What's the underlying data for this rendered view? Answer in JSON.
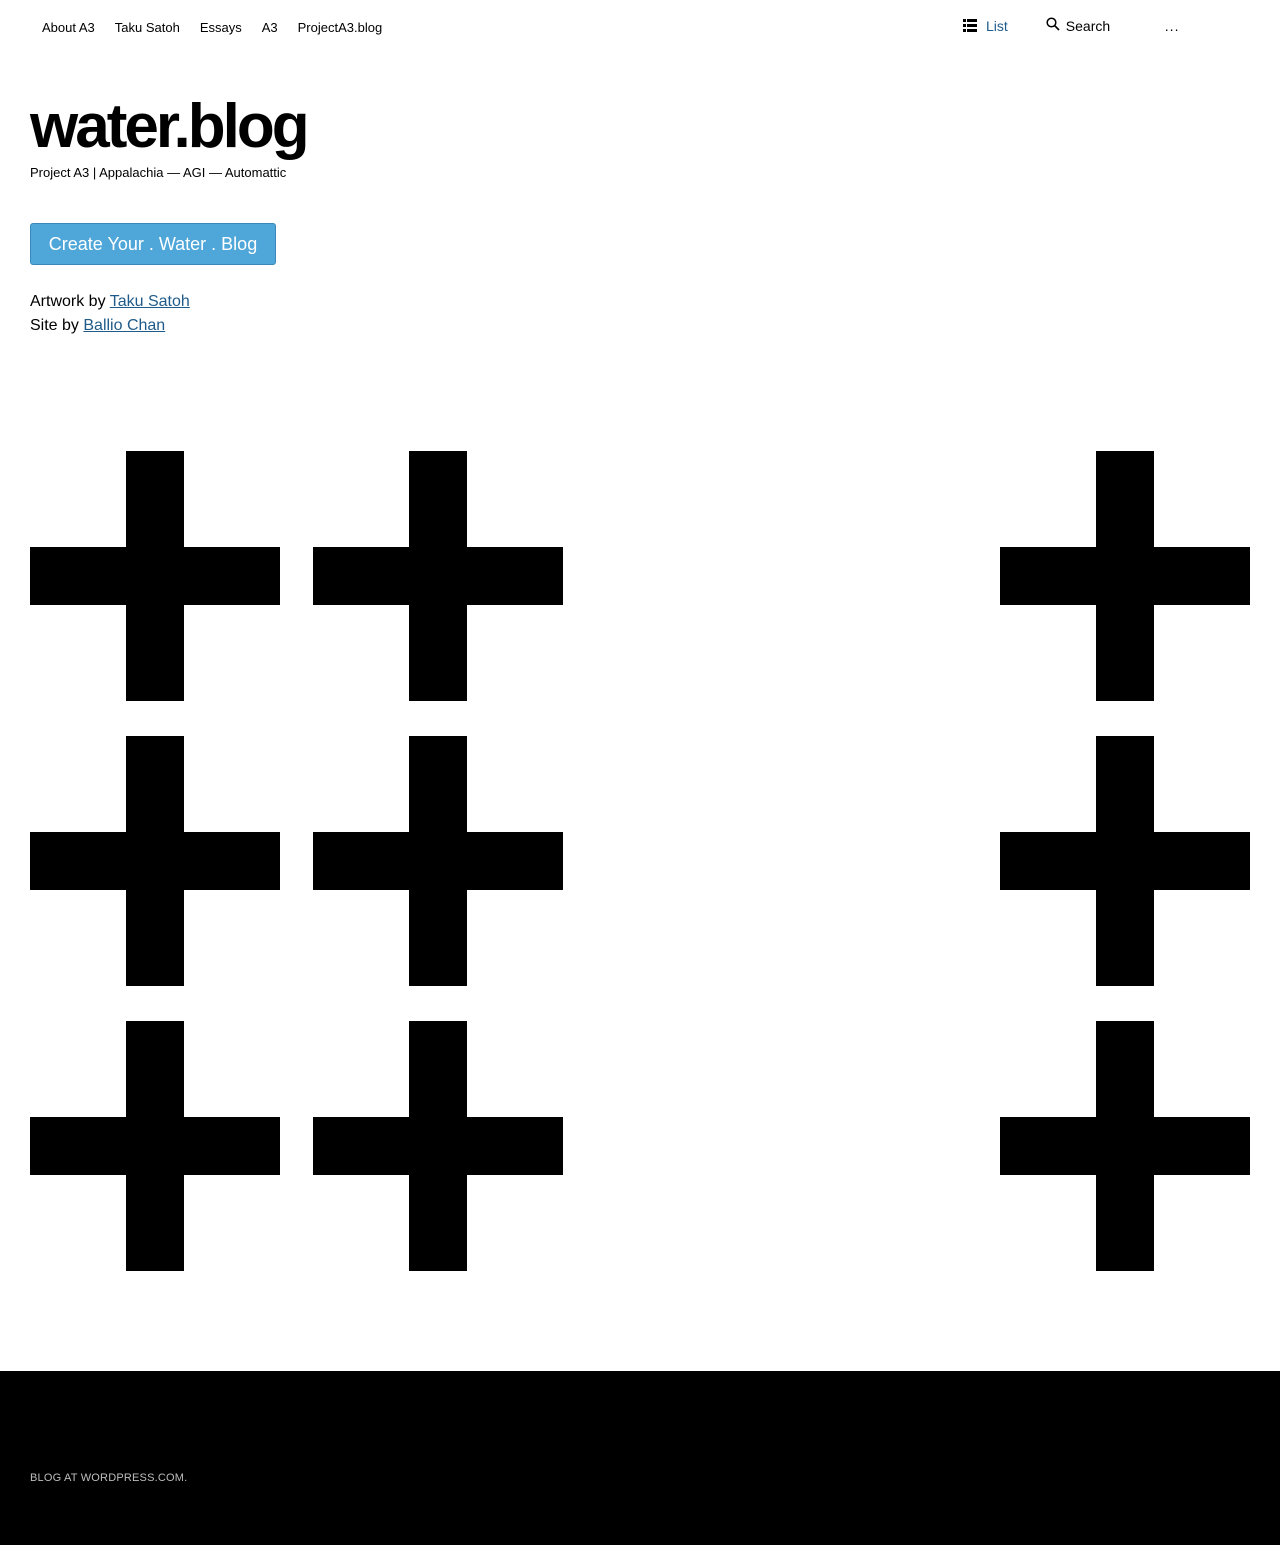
{
  "nav": {
    "links": [
      "About A3",
      "Taku Satoh",
      "Essays",
      "A3",
      "ProjectA3.blog"
    ],
    "list_label": "List",
    "search_placeholder": "Search",
    "more_label": "..."
  },
  "header": {
    "title": "water.blog",
    "tagline": "Project A3 | Appalachia — AGI — Automattic"
  },
  "cta": {
    "label": "Create Your . Water . Blog",
    "color": "#4ea6d9"
  },
  "credits": {
    "artwork_prefix": "Artwork by",
    "artwork_name": "Taku Satoh",
    "site_prefix": "Site by",
    "site_name": "Ballio Chan",
    "link_color": "#1f5b8a"
  },
  "artwork": {
    "icon": "plus-icon",
    "count": 9
  },
  "footer": {
    "text": "BLOG AT WORDPRESS.COM."
  }
}
